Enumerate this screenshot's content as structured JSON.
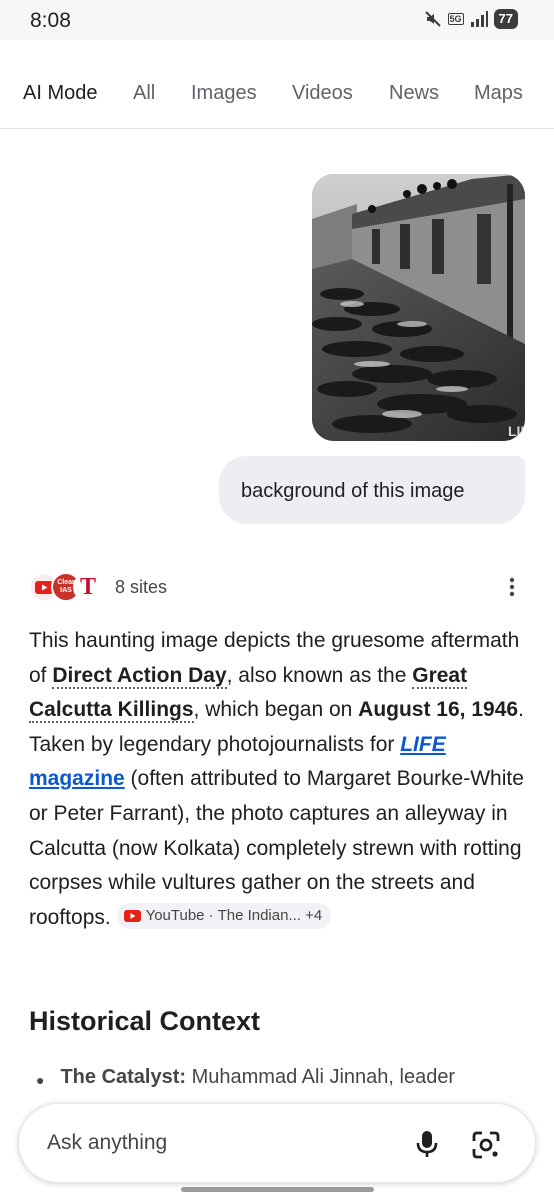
{
  "status": {
    "time": "8:08",
    "network": "5G",
    "battery": "77"
  },
  "tabs": [
    {
      "label": "AI Mode"
    },
    {
      "label": "All"
    },
    {
      "label": "Images"
    },
    {
      "label": "Videos"
    },
    {
      "label": "News"
    },
    {
      "label": "Maps"
    }
  ],
  "user_image": {
    "watermark": "LIFE"
  },
  "user_query": "background of this image",
  "sources": {
    "count_label": "8 sites",
    "fav_clear": "Clear IAS",
    "fav_t": "T"
  },
  "answer": {
    "p1": "This haunting image depicts the gruesome aftermath of ",
    "term1": "Direct Action Day",
    "p2": ", also known as the ",
    "term2": "Great Calcutta Killings",
    "p3": ", which began on ",
    "date": "August 16, 1946",
    "p4": ". Taken by legendary photojournalists for ",
    "link_italic": "LIFE",
    "link_rest": " magazine",
    "p5": " (often attributed to Margaret Bourke-White or Peter Farrant), the photo captures an alleyway in Calcutta (now Kolkata) completely strewn with rotting corpses while vultures gather on the streets and rooftops. ",
    "citation": "YouTube · The Indian... +4"
  },
  "section": {
    "title": "Historical Context",
    "bullet_label": "The Catalyst:",
    "bullet_text": " Muhammad Ali Jinnah, leader"
  },
  "ask": {
    "placeholder": "Ask anything"
  },
  "colors": {
    "link": "#0b57d0",
    "youtube_red": "#e62117",
    "chip_bg": "#f0f2f5"
  }
}
